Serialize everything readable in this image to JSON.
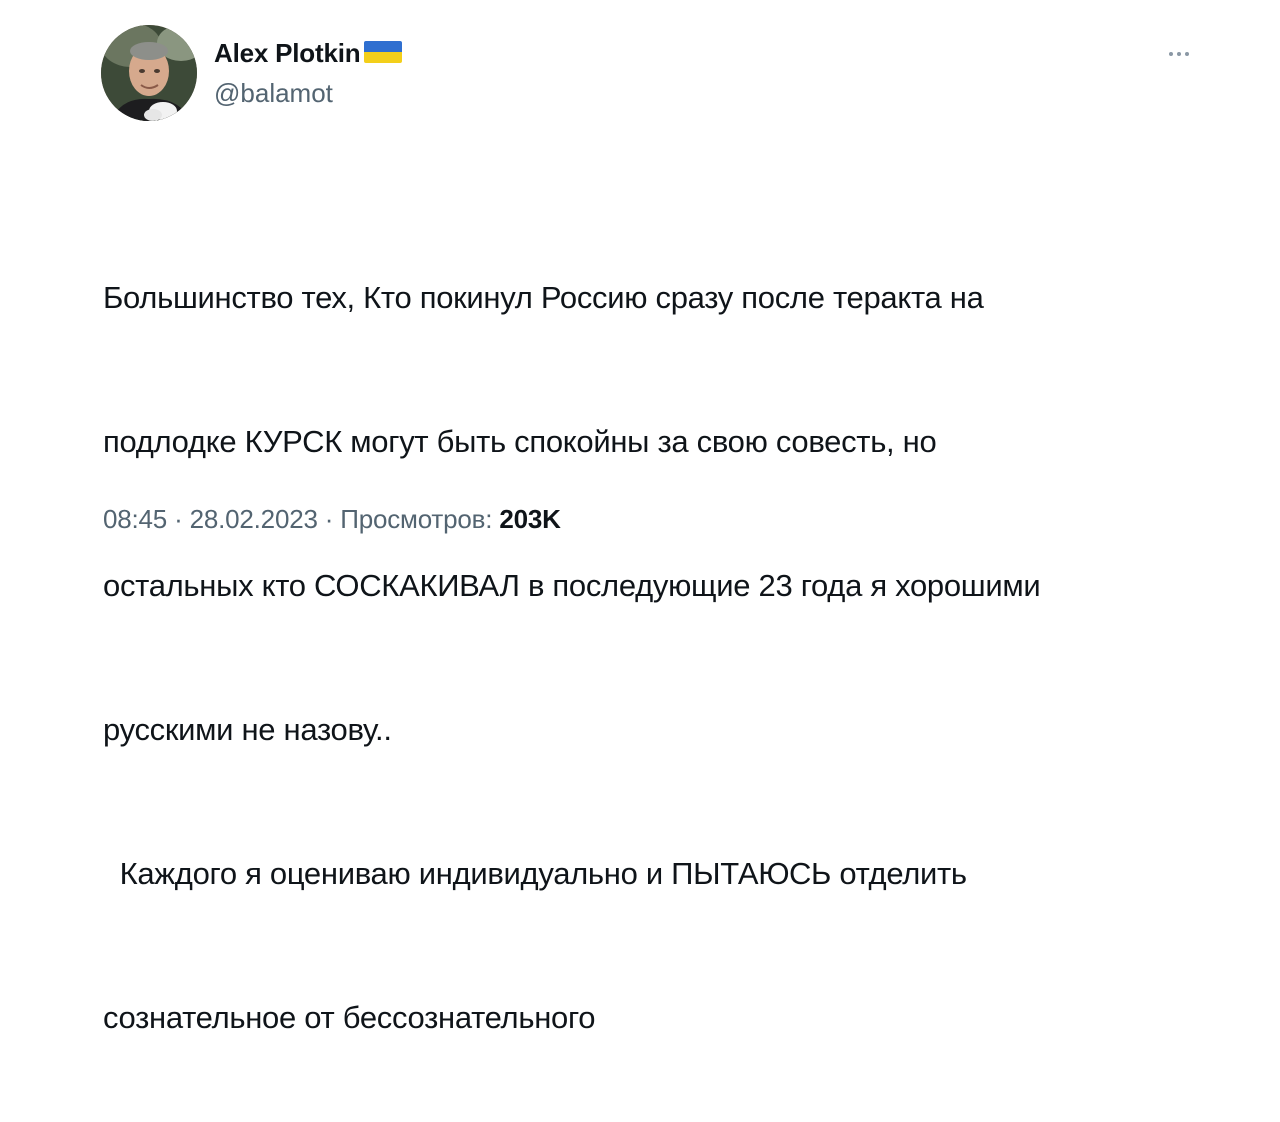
{
  "author": {
    "name": "Alex Plotkin",
    "handle": "@balamot",
    "flag": "ukraine-flag-icon",
    "flag_colors": [
      "#2f6fd0",
      "#f3cf1a"
    ]
  },
  "tweet": {
    "lines": [
      "Большинство тех, Кто покинул Россию сразу после теракта на",
      "подлодке КУРСК могут быть спокойны за свою совесть, но",
      "остальных кто СОСКАКИВАЛ в последующие 23 года я хорошими",
      "русскими не назову..",
      "  Каждого я оцениваю индивидуально и ПЫТАЮСЬ отделить",
      "сознательное от бессознательного"
    ]
  },
  "meta": {
    "time": "08:45",
    "sep1": " · ",
    "date": "28.02.2023",
    "sep2": " · ",
    "views_label": "Просмотров: ",
    "views_count": "203K"
  },
  "icons": {
    "more": "more-horizontal-icon"
  },
  "colors": {
    "text": "#0f1419",
    "secondary": "#536471"
  }
}
